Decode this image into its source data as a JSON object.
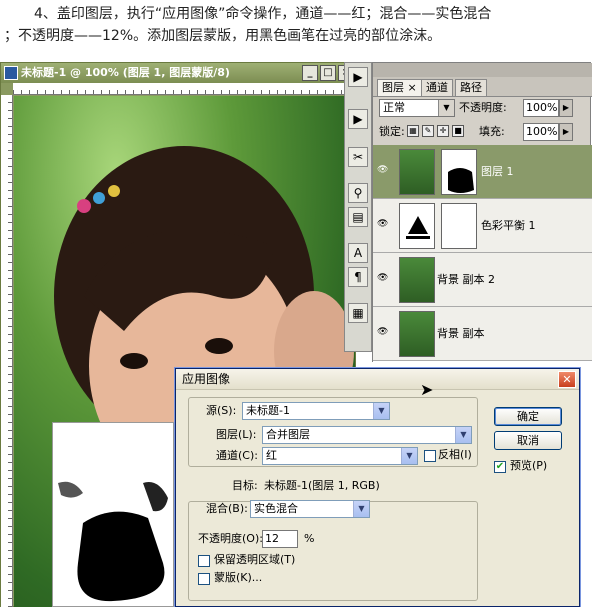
{
  "instruction": {
    "line1": "4、盖印图层，执行“应用图像”命令操作，通道——红；混合——实色混合",
    "line2": "；不透明度——12%。添加图层蒙版，用黑色画笔在过亮的部位涂沫。"
  },
  "document": {
    "title": "未标题-1 @ 100% (图层 1, 图层蒙版/8)",
    "btn_min": "_",
    "btn_max": "□",
    "btn_close": "×"
  },
  "tools": [
    "▶",
    "▶",
    "✂",
    "⚲",
    "▤",
    "A",
    "¶",
    "▦"
  ],
  "layers_panel": {
    "tabs": [
      "图层 ×",
      "通道",
      "路径"
    ],
    "blend_mode": "正常",
    "opacity_label": "不透明度:",
    "opacity_value": "100%",
    "lock_label": "锁定:",
    "fill_label": "填充:",
    "fill_value": "100%",
    "layers": [
      {
        "name": "图层 1",
        "selected": true
      },
      {
        "name": "色彩平衡 1",
        "selected": false
      },
      {
        "name": "背景 副本 2",
        "selected": false
      },
      {
        "name": "背景 副本",
        "selected": false
      }
    ]
  },
  "dialog": {
    "title": "应用图像",
    "source_label": "源(S):",
    "source_value": "未标题-1",
    "layer_label": "图层(L):",
    "layer_value": "合并图层",
    "channel_label": "通道(C):",
    "channel_value": "红",
    "invert_label": "反相(I)",
    "target_label": "目标:",
    "target_value": "未标题-1(图层 1, RGB)",
    "blending_label": "混合(B):",
    "blending_value": "实色混合",
    "opacity_label": "不透明度(O):",
    "opacity_value": "12",
    "opacity_unit": "%",
    "preserve_label": "保留透明区域(T)",
    "mask_label": "蒙版(K)...",
    "ok_label": "确定",
    "cancel_label": "取消",
    "preview_label": "预览(P)",
    "preview_checked": true
  },
  "colors": {
    "selected_layer": "#8a9a6a",
    "dialog_bg": "#ece9d8",
    "close_red": "#c8401e"
  }
}
